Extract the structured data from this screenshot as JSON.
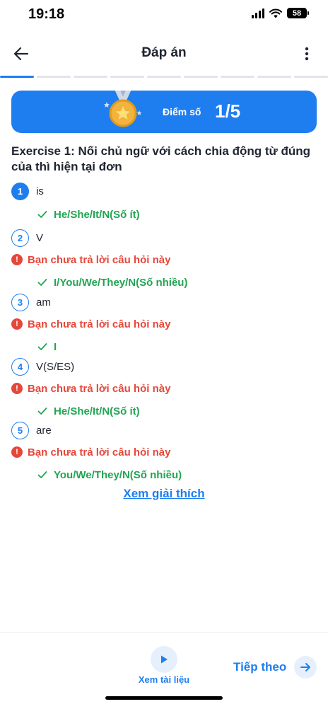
{
  "status_bar": {
    "time": "19:18",
    "battery": "58"
  },
  "header": {
    "title": "Đáp án",
    "back_icon": "arrow-left-icon",
    "more_icon": "more-vertical-icon"
  },
  "progress": {
    "total_steps": 9,
    "active_step": 1
  },
  "score": {
    "label": "Điểm số",
    "value": "1/5"
  },
  "exercise": {
    "title": "Exercise 1: Nối chủ ngữ với cách chia động từ đúng của thì hiện tại đơn"
  },
  "questions": [
    {
      "number": "1",
      "text": "is",
      "answered": true,
      "warning": "",
      "answer": "He/She/It/N(Số ít)"
    },
    {
      "number": "2",
      "text": "V",
      "answered": false,
      "warning": "Bạn chưa trả lời câu hỏi này",
      "answer": "I/You/We/They/N(Số nhiều)"
    },
    {
      "number": "3",
      "text": "am",
      "answered": false,
      "warning": "Bạn chưa trả lời câu hỏi này",
      "answer": "I"
    },
    {
      "number": "4",
      "text": "V(S/ES)",
      "answered": false,
      "warning": "Bạn chưa trả lời câu hỏi này",
      "answer": "He/She/It/N(Số ít)"
    },
    {
      "number": "5",
      "text": "are",
      "answered": false,
      "warning": "Bạn chưa trả lời câu hỏi này",
      "answer": "You/We/They/N(Số nhiều)"
    }
  ],
  "explain_link": "Xem giải thích",
  "bottom_bar": {
    "docs_label": "Xem tài liệu",
    "next_label": "Tiếp theo"
  },
  "colors": {
    "primary": "#1e7ef0",
    "correct": "#21a552",
    "error": "#e5483b"
  }
}
